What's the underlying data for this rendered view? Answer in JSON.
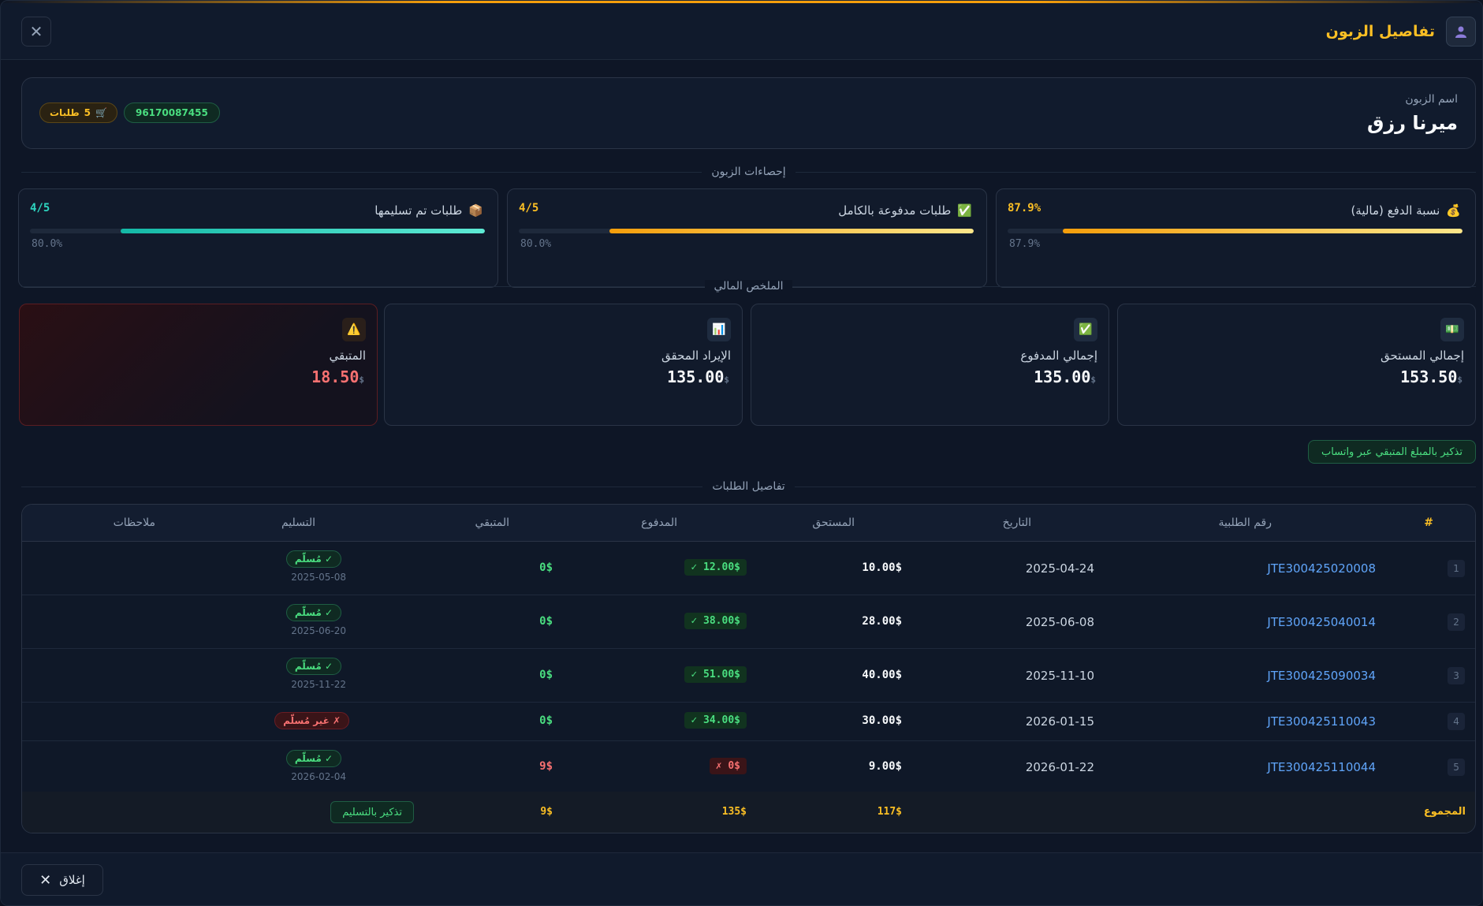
{
  "header": {
    "title": "تفاصيل الزبون",
    "close_glyph": "✕"
  },
  "customer": {
    "label": "اسم الزبون",
    "name": "ميرنا رزق",
    "phone": "96170087455",
    "orders_count": "5",
    "orders_word": "طلبات"
  },
  "sections": {
    "stats": "إحصاءات الزبون",
    "finance": "الملخص المالي",
    "orders": "تفاصيل الطلبات"
  },
  "stats": [
    {
      "icon": "💰",
      "label": "نسبة الدفع (مالية)",
      "ratio": "87.9%",
      "percent": 87.9,
      "pct_text": "87.9%",
      "color": "#f59e0b",
      "ratio_color": "#fbbf24"
    },
    {
      "icon": "✅",
      "label": "طلبات مدفوعة بالكامل",
      "ratio": "4/5",
      "percent": 80.0,
      "pct_text": "80.0%",
      "color": "#f59e0b",
      "ratio_color": "#fbbf24"
    },
    {
      "icon": "📦",
      "label": "طلبات تم تسليمها",
      "ratio": "4/5",
      "percent": 80.0,
      "pct_text": "80.0%",
      "color": "#14b8a6",
      "ratio_color": "#2dd4bf"
    }
  ],
  "finance": [
    {
      "icon": "💵",
      "label": "إجمالي المستحق",
      "value": "153.50",
      "currency": "$"
    },
    {
      "icon": "✅",
      "label": "إجمالي المدفوع",
      "value": "135.00",
      "currency": "$"
    },
    {
      "icon": "📊",
      "label": "الإيراد المحقق",
      "value": "135.00",
      "currency": "$"
    },
    {
      "icon": "⚠️",
      "label": "المتبقي",
      "value": "18.50",
      "currency": "$"
    }
  ],
  "whatsapp_button": "تذكير بالمبلغ المتبقي عبر واتساب",
  "table": {
    "headers": {
      "num": "#",
      "order": "رقم الطلبية",
      "date": "التاريخ",
      "due": "المستحق",
      "paid": "المدفوع",
      "remaining": "المتبقي",
      "delivery": "التسليم",
      "notes": "ملاحظات"
    },
    "rows": [
      {
        "idx": "1",
        "order": "JTE300425020008",
        "date": "2025-04-24",
        "due": "10.00$",
        "paid": "12.00$ ✓",
        "remaining": "0$",
        "delivery": "✓ مُسلّم",
        "delivery_date": "2025-05-08"
      },
      {
        "idx": "2",
        "order": "JTE300425040014",
        "date": "2025-06-08",
        "due": "28.00$",
        "paid": "38.00$ ✓",
        "remaining": "0$",
        "delivery": "✓ مُسلّم",
        "delivery_date": "2025-06-20"
      },
      {
        "idx": "3",
        "order": "JTE300425090034",
        "date": "2025-11-10",
        "due": "40.00$",
        "paid": "51.00$ ✓",
        "remaining": "0$",
        "delivery": "✓ مُسلّم",
        "delivery_date": "2025-11-22"
      },
      {
        "idx": "4",
        "order": "JTE300425110043",
        "date": "2026-01-15",
        "due": "30.00$",
        "paid": "34.00$ ✓",
        "remaining": "0$",
        "delivery": "✗ غير مُسلّم",
        "delivery_date": ""
      },
      {
        "idx": "5",
        "order": "JTE300425110044",
        "date": "2026-01-22",
        "due": "9.00$",
        "paid": "0$ ✗",
        "remaining": "9$",
        "delivery": "✓ مُسلّم",
        "delivery_date": "2026-02-04"
      }
    ],
    "totals": {
      "label": "المجموع",
      "due": "117$",
      "paid": "135$",
      "remaining": "9$",
      "delivery_button": "تذكير بالتسليم"
    }
  },
  "footer": {
    "close_label": "إغلاق",
    "close_glyph": "✕"
  }
}
